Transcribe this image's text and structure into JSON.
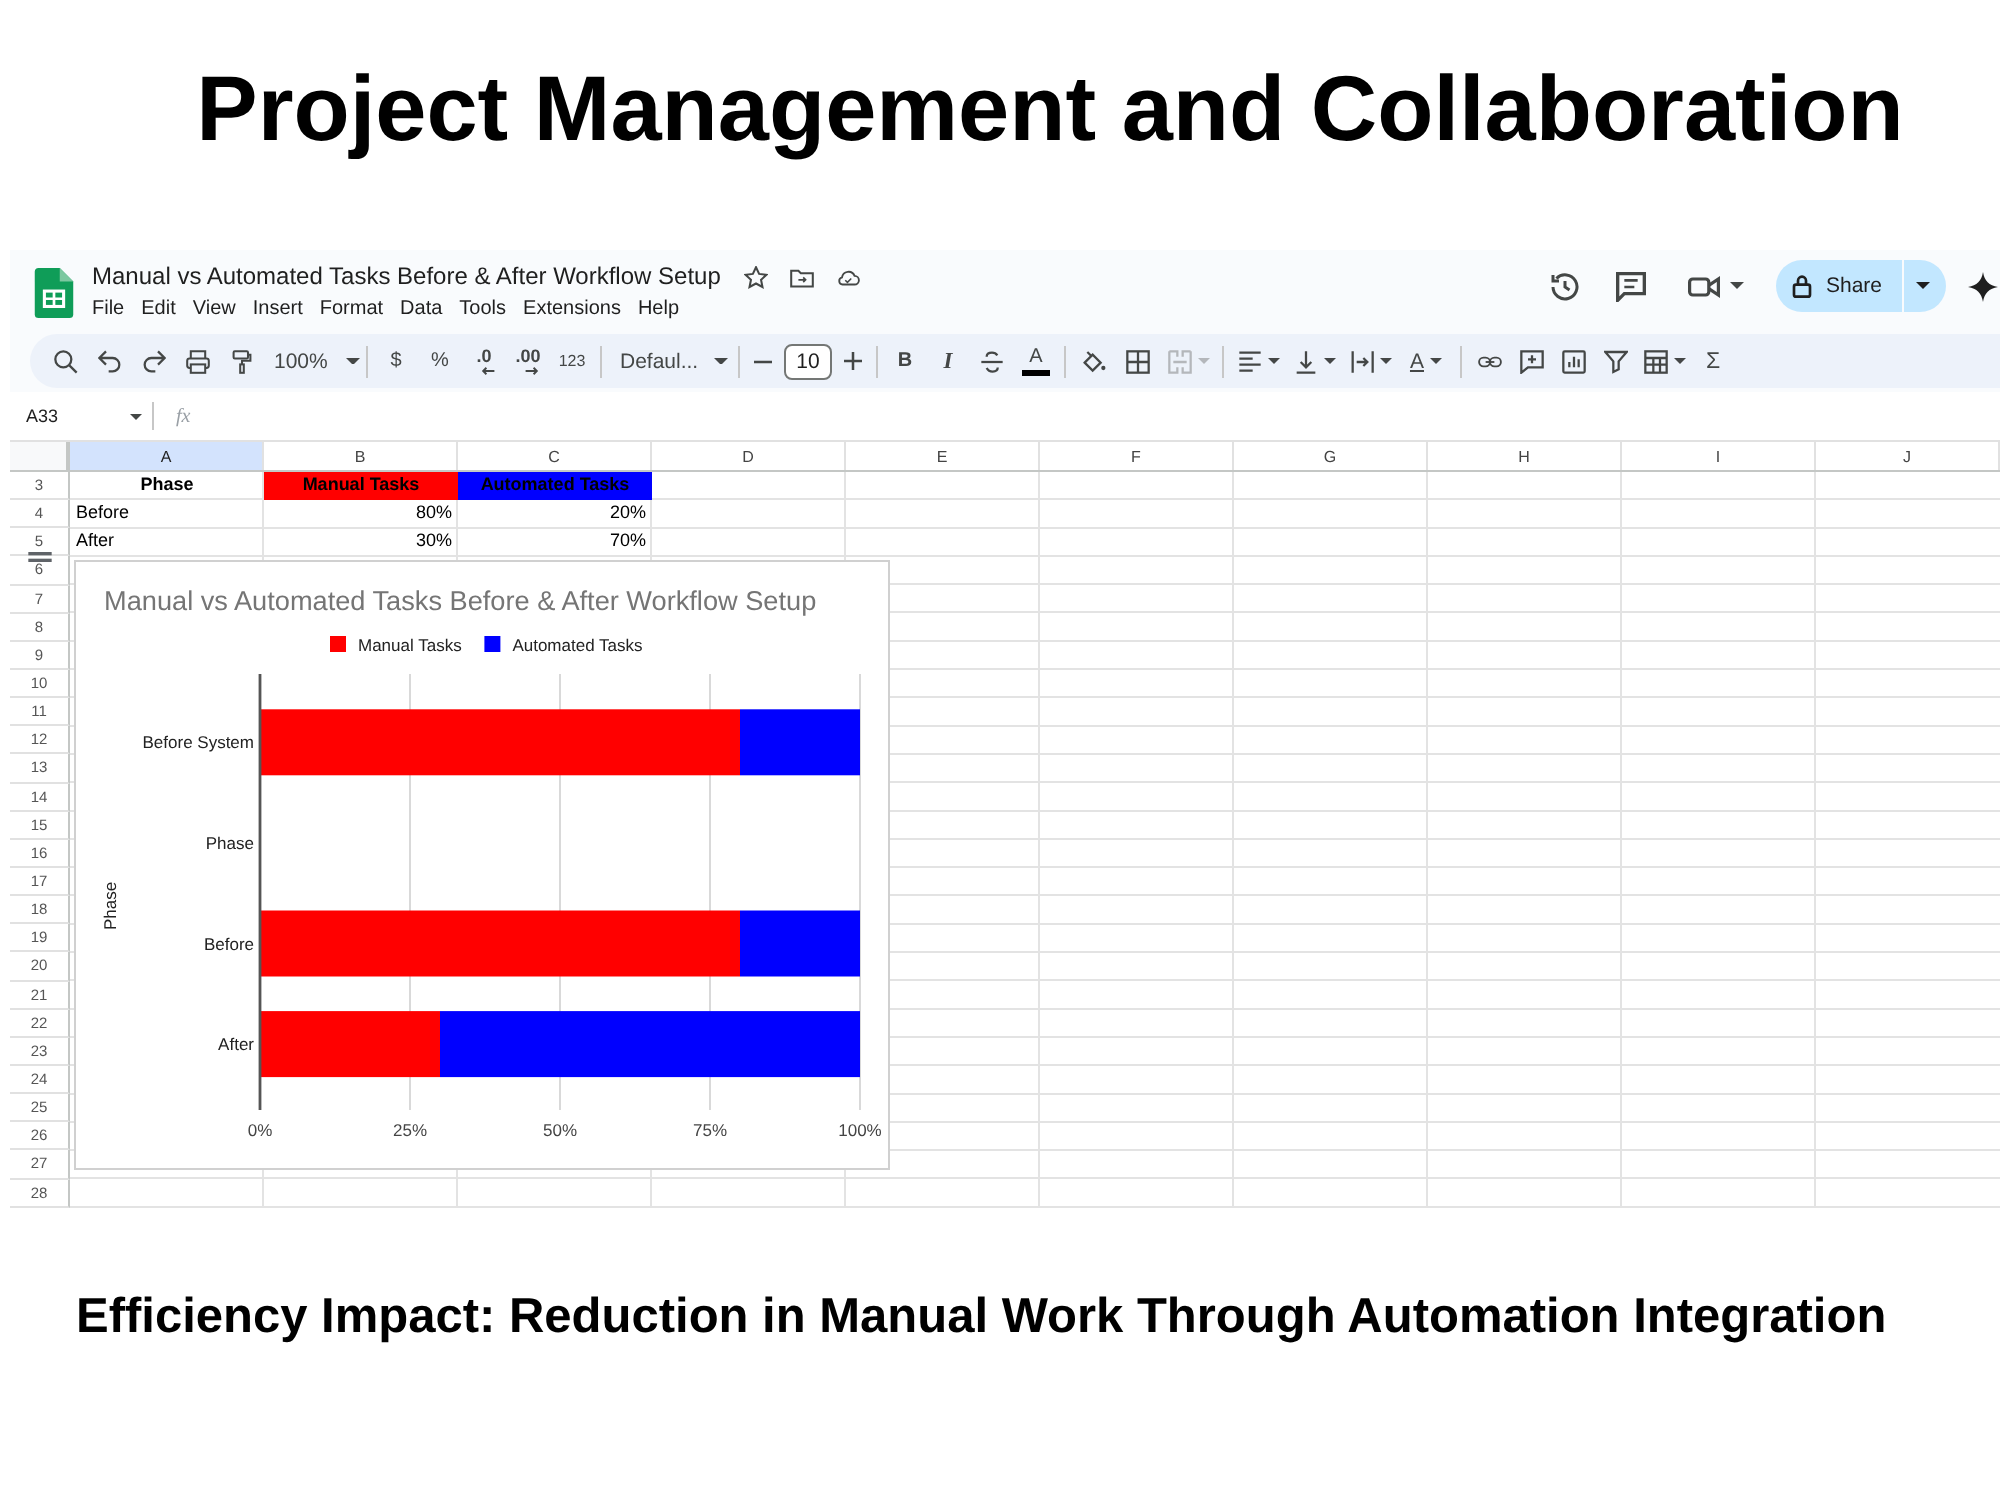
{
  "headline": "Project Management and Collaboration",
  "app": {
    "title": "Manual vs Automated Tasks Before & After Workflow Setup",
    "menu": [
      "File",
      "Edit",
      "View",
      "Insert",
      "Format",
      "Data",
      "Tools",
      "Extensions",
      "Help"
    ],
    "share_button": "Share",
    "toolbar": {
      "zoom": "100%",
      "currency": "$",
      "percent": "%",
      "decrease_decimal": ".0",
      "increase_decimal": ".00",
      "number_format": "123",
      "font": "Defaul...",
      "font_size": "10",
      "bold": "B",
      "italic": "I",
      "text_color": "A",
      "merge": {
        "disabled": true
      },
      "text_rotation": "A",
      "functions": "Σ"
    },
    "formula_bar": {
      "name_box": "A33",
      "fx": "fx"
    },
    "sheet": {
      "columns": [
        {
          "label": "A",
          "selected": true
        },
        {
          "label": "B",
          "selected": false
        },
        {
          "label": "C",
          "selected": false
        },
        {
          "label": "D",
          "selected": false
        },
        {
          "label": "E",
          "selected": false
        },
        {
          "label": "F",
          "selected": false
        },
        {
          "label": "G",
          "selected": false
        },
        {
          "label": "H",
          "selected": false
        },
        {
          "label": "I",
          "selected": false
        },
        {
          "label": "J",
          "selected": false
        }
      ],
      "rows": [
        {
          "number": "3",
          "cells": [
            {
              "kind": "header",
              "text": "Phase"
            },
            {
              "kind": "header",
              "text": "Manual Tasks",
              "color": "#ff0000"
            },
            {
              "kind": "header",
              "text": "Automated Tasks",
              "color": "#0000ff"
            }
          ]
        },
        {
          "number": "4",
          "cells": [
            {
              "kind": "text",
              "text": "Before"
            },
            {
              "kind": "number",
              "text": "80%"
            },
            {
              "kind": "number",
              "text": "20%"
            }
          ]
        },
        {
          "number": "5",
          "cells": [
            {
              "kind": "text",
              "text": "After"
            },
            {
              "kind": "number",
              "text": "30%"
            },
            {
              "kind": "number",
              "text": "70%"
            }
          ]
        },
        {
          "number": "6"
        },
        {
          "number": "7"
        },
        {
          "number": "8"
        },
        {
          "number": "9"
        },
        {
          "number": "10"
        },
        {
          "number": "11"
        },
        {
          "number": "12"
        },
        {
          "number": "13"
        },
        {
          "number": "14"
        },
        {
          "number": "15"
        },
        {
          "number": "16"
        },
        {
          "number": "17"
        },
        {
          "number": "18"
        },
        {
          "number": "19"
        },
        {
          "number": "20"
        },
        {
          "number": "21"
        },
        {
          "number": "22"
        },
        {
          "number": "23"
        },
        {
          "number": "24"
        },
        {
          "number": "25"
        },
        {
          "number": "26"
        },
        {
          "number": "27"
        },
        {
          "number": "28"
        }
      ]
    },
    "chart": {
      "chart_data": {
        "type": "bar",
        "title": "Manual vs Automated Tasks Before & After Workflow Setup",
        "ylabel": "Phase",
        "categories": [
          "Before System",
          "Phase",
          "Before",
          "After"
        ],
        "series": [
          {
            "name": "Manual Tasks",
            "color": "#ff0000",
            "values": [
              80,
              null,
              80,
              30
            ]
          },
          {
            "name": "Automated Tasks",
            "color": "#0000ff",
            "values": [
              20,
              null,
              20,
              70
            ]
          }
        ],
        "xlim": [
          0,
          100
        ],
        "xticks": [
          {
            "value": 0,
            "label": "0%"
          },
          {
            "value": 25,
            "label": "25%"
          },
          {
            "value": 50,
            "label": "50%"
          },
          {
            "value": 75,
            "label": "75%"
          },
          {
            "value": 100,
            "label": "100%"
          }
        ],
        "stacked": true,
        "orientation": "horizontal",
        "grid": true,
        "legend": "top"
      }
    }
  },
  "caption": "Efficiency Impact: Reduction in Manual Work Through Automation Integration"
}
